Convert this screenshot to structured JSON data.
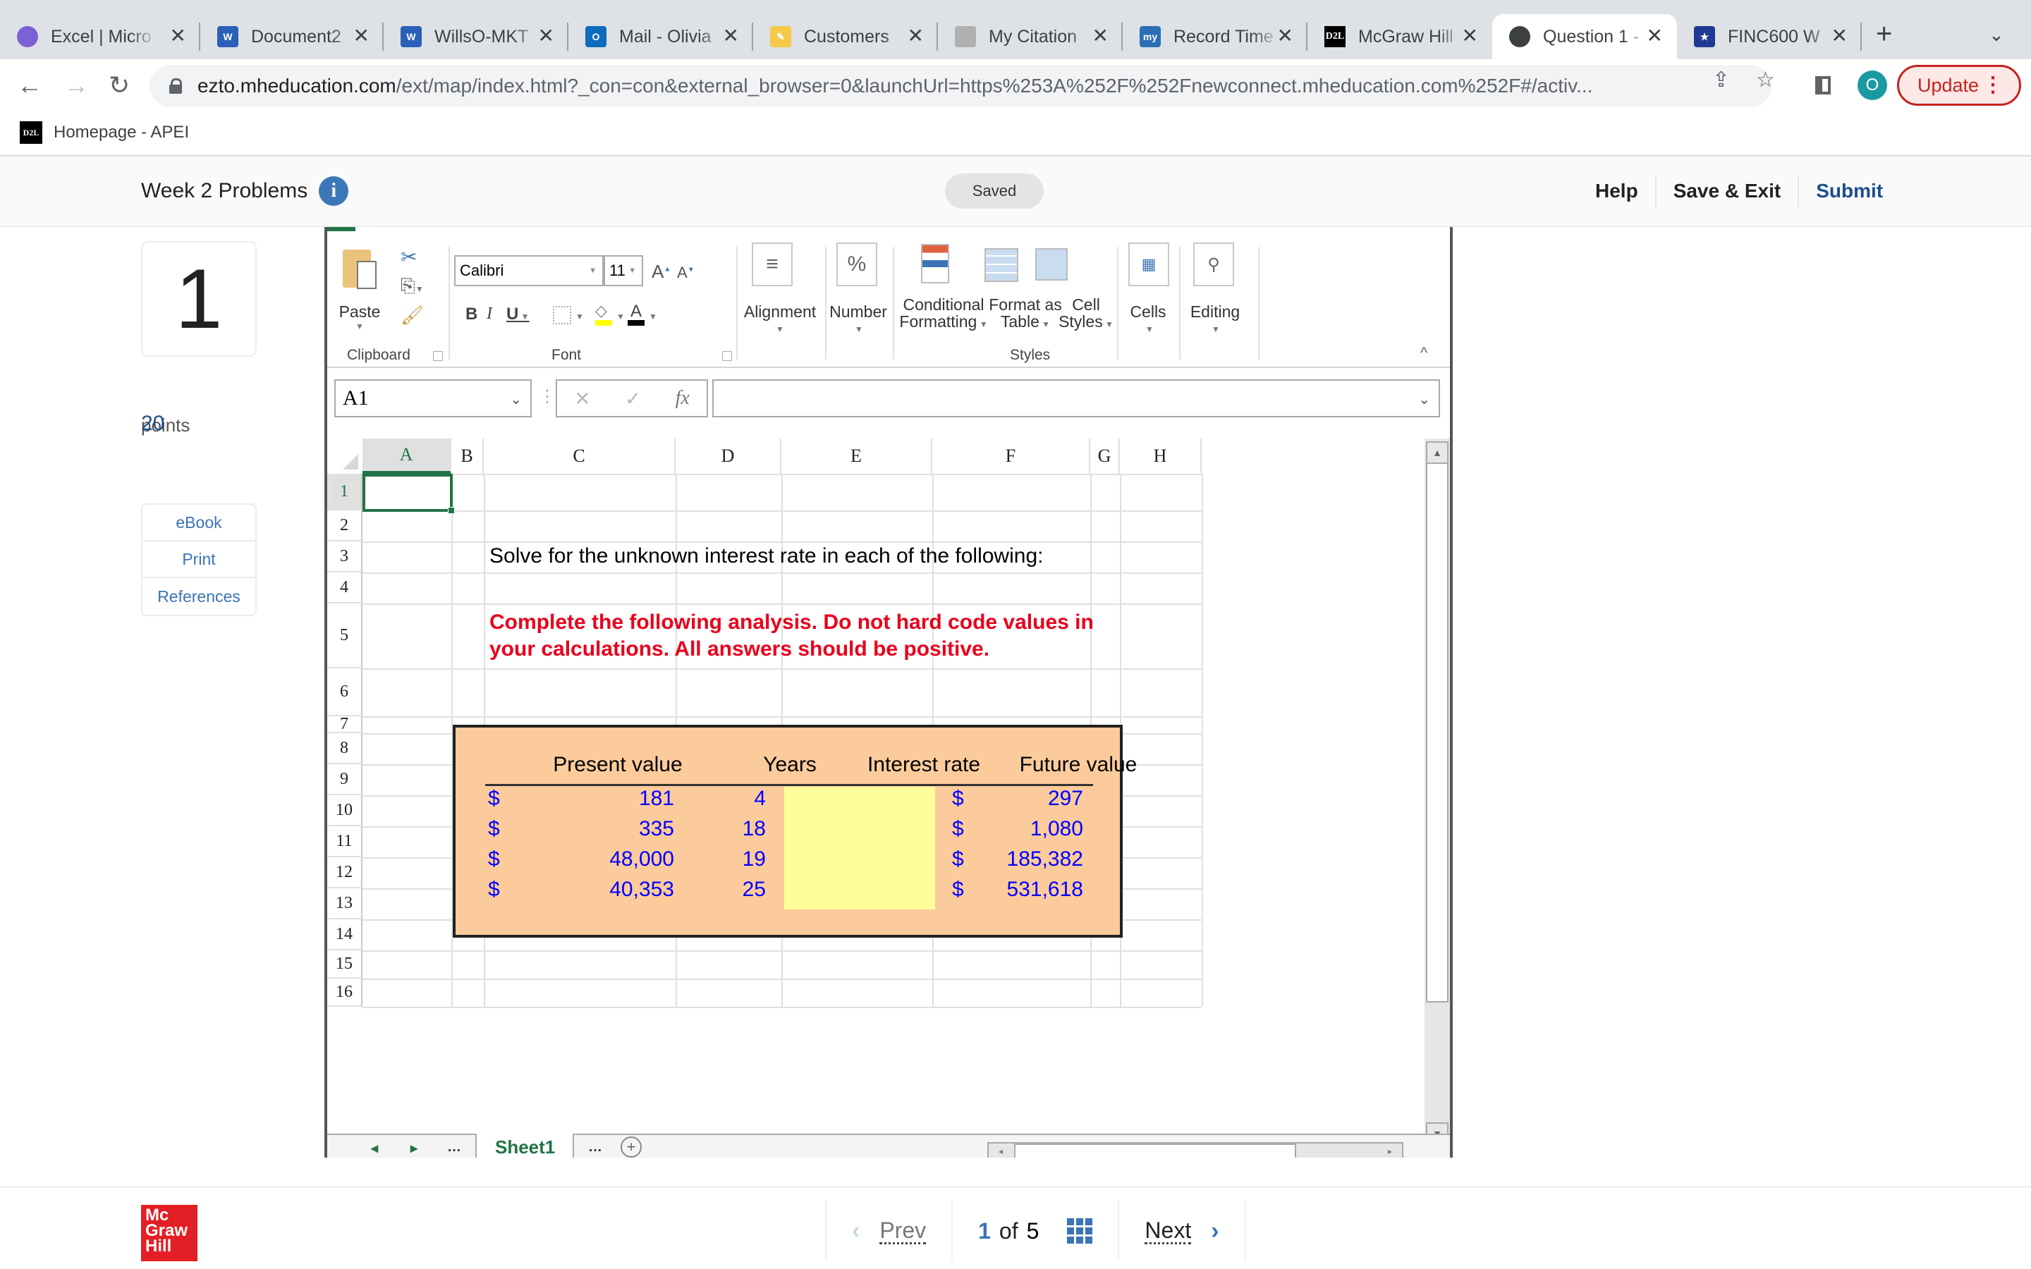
{
  "browser": {
    "tabs": [
      {
        "title": "Excel | Micro",
        "icon": "microsoft365-icon",
        "color": "#7b61d4"
      },
      {
        "title": "Document2",
        "icon": "word-icon",
        "color": "#2b5fb8"
      },
      {
        "title": "WillsO-MKT",
        "icon": "word-icon",
        "color": "#2b5fb8"
      },
      {
        "title": "Mail - Olivia",
        "icon": "outlook-icon",
        "color": "#0f6cbd"
      },
      {
        "title": "Customers",
        "icon": "pencil-icon",
        "color": "#f7c948"
      },
      {
        "title": "My Citation",
        "icon": "squirrel-icon",
        "color": "#9a9a9a"
      },
      {
        "title": "Record Time",
        "icon": "my-icon",
        "color": "#2a6fb5"
      },
      {
        "title": "McGraw Hill",
        "icon": "d2l-icon",
        "color": "#000000"
      },
      {
        "title": "Question 1 -",
        "icon": "globe-icon",
        "color": "#3c4043",
        "active": true
      },
      {
        "title": "FINC600 W",
        "icon": "shield-star-icon",
        "color": "#1f3a93"
      }
    ],
    "new_tab_label": "+",
    "url_host": "ezto.mheducation.com",
    "url_path": "/ext/map/index.html?_con=con&external_browser=0&launchUrl=https%253A%252F%252Fnewconnect.mheducation.com%252F#/activ...",
    "profile_initial": "O",
    "update_label": "Update",
    "bookmark": {
      "label": "Homepage - APEI",
      "icon_text": "D2L"
    }
  },
  "assignment": {
    "title": "Week 2 Problems",
    "saved_label": "Saved",
    "actions": [
      "Help",
      "Save & Exit",
      "Submit"
    ]
  },
  "question": {
    "number": "1",
    "points": "20",
    "points_label": "points",
    "links": [
      "eBook",
      "Print",
      "References"
    ]
  },
  "excel": {
    "ribbon": {
      "clipboard": {
        "paste": "Paste",
        "group": "Clipboard"
      },
      "font": {
        "name": "Calibri",
        "size": "11",
        "group": "Font",
        "bold": "B",
        "italic": "I",
        "underline": "U"
      },
      "alignment": "Alignment",
      "number": "Number",
      "number_symbol": "%",
      "styles": {
        "conditional": [
          "Conditional",
          "Formatting"
        ],
        "format_table": [
          "Format as",
          "Table"
        ],
        "cell_styles": [
          "Cell",
          "Styles"
        ],
        "group": "Styles"
      },
      "cells": "Cells",
      "editing": "Editing"
    },
    "name_box": "A1",
    "formula": "",
    "fx_label": "fx",
    "columns": [
      "A",
      "B",
      "C",
      "D",
      "E",
      "F",
      "G",
      "H"
    ],
    "rows": [
      "1",
      "2",
      "3",
      "4",
      "5",
      "6",
      "7",
      "8",
      "9",
      "10",
      "11",
      "12",
      "13",
      "14",
      "15",
      "16"
    ],
    "selected_cell": "A1",
    "instruction": "Solve for the unknown interest rate in each of the following:",
    "warning": "Complete the following analysis. Do not hard code values in your calculations. All answers should be positive.",
    "table": {
      "headers": [
        "Present value",
        "Years",
        "Interest rate",
        "Future value"
      ],
      "currency": "$",
      "rows": [
        {
          "pv": "181",
          "years": "4",
          "rate": "",
          "fv": "297"
        },
        {
          "pv": "335",
          "years": "18",
          "rate": "",
          "fv": "1,080"
        },
        {
          "pv": "48,000",
          "years": "19",
          "rate": "",
          "fv": "185,382"
        },
        {
          "pv": "40,353",
          "years": "25",
          "rate": "",
          "fv": "531,618"
        }
      ]
    },
    "sheet_tab": "Sheet1",
    "colors": {
      "accent": "#217346",
      "box_fill": "#fccb9c",
      "input_fill": "#fdfd9a",
      "value_text": "#0000ff",
      "warning_text": "#e8001c"
    }
  },
  "footer": {
    "logo": [
      "Mc",
      "Graw",
      "Hill"
    ],
    "prev_label": "Prev",
    "current_page": "1",
    "of_label": "of",
    "total_pages": "5",
    "next_label": "Next"
  }
}
